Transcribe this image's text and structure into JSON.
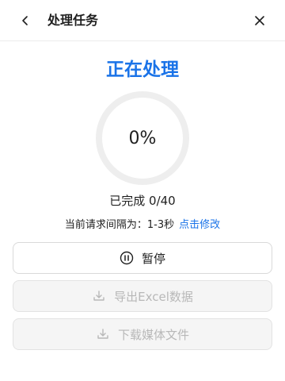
{
  "header": {
    "title": "处理任务"
  },
  "status": {
    "title": "正在处理"
  },
  "progress": {
    "percent": 0,
    "percent_label": "0%"
  },
  "completed": {
    "text": "已完成 0/40"
  },
  "interval": {
    "text": "当前请求间隔为：1-3秒",
    "modify_label": "点击修改"
  },
  "buttons": {
    "pause_label": "暂停",
    "export_label": "导出Excel数据",
    "download_label": "下载媒体文件"
  },
  "icons": {
    "back": "chevron-left-icon",
    "close": "close-icon",
    "pause": "pause-circle-icon",
    "download": "download-icon"
  },
  "colors": {
    "accent": "#1a73e8",
    "ring_track": "#eeeeee",
    "disabled_text": "#b8b8b8",
    "disabled_bg": "#f5f5f5"
  }
}
